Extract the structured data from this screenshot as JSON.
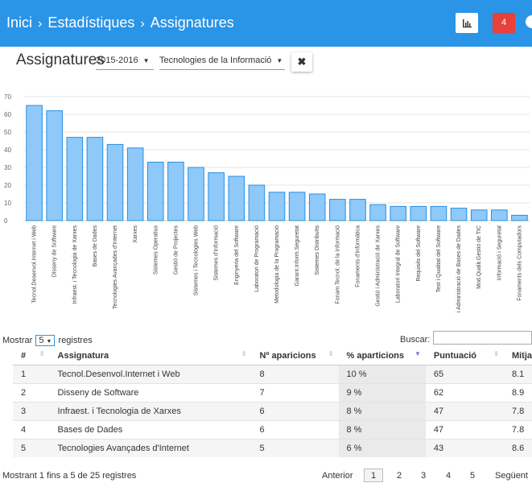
{
  "breadcrumb": {
    "items": [
      "Inici",
      "Estadístiques",
      "Assignatures"
    ],
    "separator": "›"
  },
  "toolbar": {
    "chart_icon": "bar-chart-icon",
    "alert_count": "4"
  },
  "page": {
    "title": "Assignatures"
  },
  "filters": {
    "year": "2015-2016",
    "degree": "Tecnologies de la Informació",
    "clear_symbol": "✖"
  },
  "chart_data": {
    "type": "bar",
    "color": "#8ec9f9",
    "stroke": "#2a8fe0",
    "ylim": [
      0,
      70
    ],
    "yticks": [
      0,
      10,
      20,
      30,
      40,
      50,
      60,
      70
    ],
    "grid": true,
    "categories": [
      "Tecnol.Desenvol.Internet i Web",
      "Disseny de Software",
      "Infraest. i Tecnologia de Xarxes",
      "Bases de Dades",
      "Tecnologies Avançades d'Internet",
      "Xarxes",
      "Sistemes Operatius",
      "Gestió de Projectes",
      "Sistemes i Tecnologies Web",
      "Sistemes d'Informació",
      "Enginyeria del Software",
      "Laboratori de Programació",
      "Metodologia de la Programació",
      "Garant.Inform.Seguretat",
      "Sistemes Distribuïts",
      "Fonam.Tecnol. de la Informació",
      "Fonaments d'Informàtica",
      "Gestió i Administració de Xarxes",
      "Laboratori Integral de Software",
      "Requisits del Software",
      "Test i Qualitat del Software",
      "i Administració de Bases de Dades",
      "Mod.Qualit.Gestió de TIC",
      "Informació i Seguretat",
      "Fonaments dels Computadors"
    ],
    "values": [
      65,
      62,
      47,
      47,
      43,
      41,
      33,
      33,
      30,
      27,
      25,
      20,
      16,
      16,
      15,
      12,
      12,
      9,
      8,
      8,
      8,
      7,
      6,
      6,
      3
    ]
  },
  "table": {
    "length_prefix": "Mostrar",
    "length_value": "5",
    "length_suffix": "registres",
    "search_label": "Buscar:",
    "columns": [
      "#",
      "Assignatura",
      "Nº aparicions",
      "% aparticions",
      "Puntuació",
      "Mitja"
    ],
    "rows": [
      [
        "1",
        "Tecnol.Desenvol.Internet i Web",
        "8",
        "10 %",
        "65",
        "8.1"
      ],
      [
        "2",
        "Disseny de Software",
        "7",
        "9 %",
        "62",
        "8.9"
      ],
      [
        "3",
        "Infraest. i Tecnologia de Xarxes",
        "6",
        "8 %",
        "47",
        "7.8"
      ],
      [
        "4",
        "Bases de Dades",
        "6",
        "8 %",
        "47",
        "7.8"
      ],
      [
        "5",
        "Tecnologies Avançades d'Internet",
        "5",
        "6 %",
        "43",
        "8.6"
      ]
    ],
    "info": "Mostrant 1 fins a 5 de 25 registres",
    "pagination": {
      "prev": "Anterior",
      "pages": [
        "1",
        "2",
        "3",
        "4",
        "5"
      ],
      "current": "1",
      "next": "Següent"
    }
  }
}
